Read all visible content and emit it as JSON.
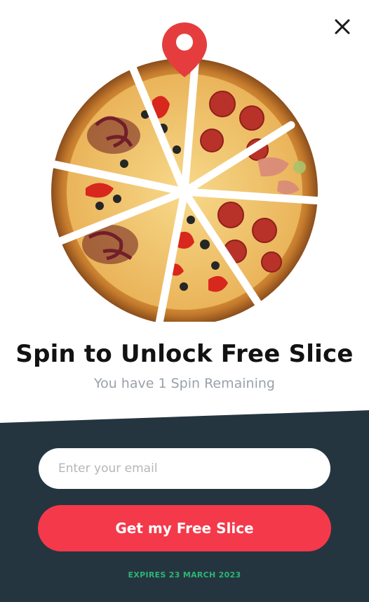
{
  "popup": {
    "title": "Spin to Unlock Free Slice",
    "subtitle": "You have 1 Spin Remaining"
  },
  "form": {
    "email_placeholder": "Enter your email",
    "email_value": "",
    "submit_label": "Get my Free Slice"
  },
  "footer": {
    "expires_text": "EXPIRES 23 MARCH 2023"
  },
  "icons": {
    "close": "close-icon",
    "pointer": "map-pin-icon",
    "wheel": "pizza-wheel"
  },
  "colors": {
    "accent": "#f4394a",
    "dark_panel": "#253540",
    "expiry_green": "#2bb673"
  }
}
